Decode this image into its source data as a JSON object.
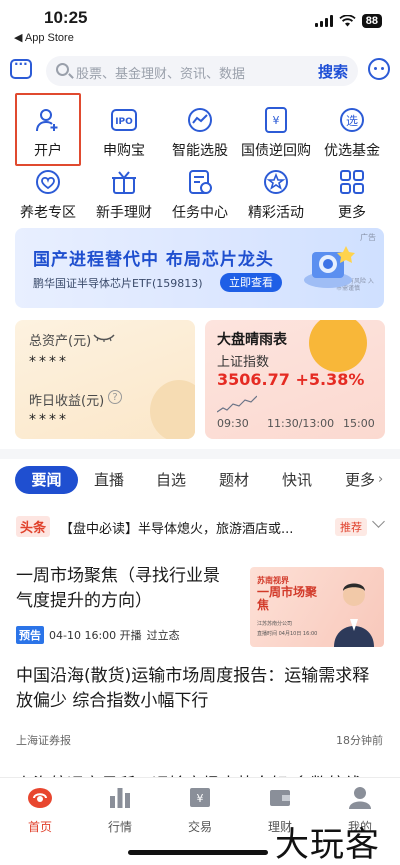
{
  "status_bar": {
    "time": "10:25",
    "back_app": "◀ App Store",
    "battery": "88"
  },
  "search": {
    "placeholder": "股票、基金理财、资讯、数据",
    "button": "搜索"
  },
  "icon_grid": [
    {
      "label": "开户",
      "icon": "user-plus-icon"
    },
    {
      "label": "申购宝",
      "icon": "ipo-icon"
    },
    {
      "label": "智能选股",
      "icon": "trend-icon"
    },
    {
      "label": "国债逆回购",
      "icon": "bond-icon"
    },
    {
      "label": "优选基金",
      "icon": "fund-select-icon"
    },
    {
      "label": "养老专区",
      "icon": "heart-shield-icon"
    },
    {
      "label": "新手理财",
      "icon": "gift-icon"
    },
    {
      "label": "任务中心",
      "icon": "task-icon"
    },
    {
      "label": "精彩活动",
      "icon": "star-badge-icon"
    },
    {
      "label": "更多",
      "icon": "grid-icon"
    }
  ],
  "ipo_icon_text": "IPO",
  "fund_icon_text": "选",
  "bond_icon_text": "¥",
  "banner": {
    "title": "国产进程替代中  布局芯片龙头",
    "subtitle": "鹏华国证半导体芯片ETF(159813)",
    "cta": "立即查看",
    "ad_tag": "广告",
    "fine_print": "投资有风险 入市需谨慎"
  },
  "asset_card": {
    "total_label": "总资产(元)",
    "total_value": "****",
    "yesterday_label": "昨日收益(元)",
    "yesterday_value": "****",
    "help_icon": "?"
  },
  "market_card": {
    "title": "大盘晴雨表",
    "index_name": "上证指数",
    "index_value": "3506.77",
    "index_change": "+5.38%",
    "times": [
      "09:30",
      "11:30/13:00",
      "15:00"
    ]
  },
  "tabs": {
    "items": [
      "要闻",
      "直播",
      "自选",
      "题材",
      "快讯",
      "更多"
    ],
    "active": "要闻"
  },
  "headline": {
    "tag": "头条",
    "text": "【盘中必读】半导体熄火，旅游酒店或...",
    "badge": "推荐"
  },
  "articles": [
    {
      "title": "一周市场聚焦（寻找行业景气度提升的方向）",
      "pre_tag": "预告",
      "time": "04-10 16:00 开播",
      "host": "过立态",
      "thumb_top": "苏南视界",
      "thumb_title": "一周市场聚焦",
      "thumb_org": "江苏苏南分公司",
      "thumb_time": "直播时间 04月10日 16:00"
    },
    {
      "title": "中国沿海(散货)运输市场周度报告：运输需求释放偏少 综合指数小幅下行",
      "source": "上海证券报",
      "time": "18分钟前"
    },
    {
      "title": "上海航运交易所：运输市场走势向好 多数航线"
    }
  ],
  "bottom_nav": [
    {
      "label": "首页",
      "icon": "home-icon",
      "active": true
    },
    {
      "label": "行情",
      "icon": "bar-chart-icon",
      "active": false
    },
    {
      "label": "交易",
      "icon": "trade-icon",
      "active": false
    },
    {
      "label": "理财",
      "icon": "wallet-icon",
      "active": false
    },
    {
      "label": "我的",
      "icon": "profile-icon",
      "active": false
    }
  ],
  "watermark": "大玩客",
  "colors": {
    "brand_blue": "#1f4fd0",
    "rise_red": "#e52b23",
    "highlight_box": "#e04a2f"
  }
}
